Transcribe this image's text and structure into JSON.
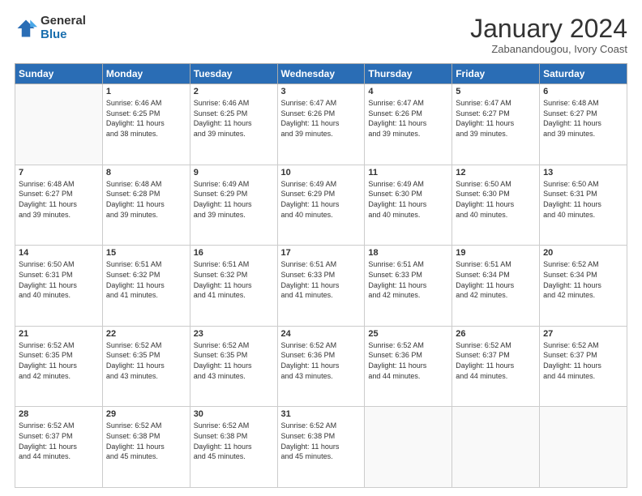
{
  "logo": {
    "general": "General",
    "blue": "Blue"
  },
  "header": {
    "month": "January 2024",
    "location": "Zabanandougou, Ivory Coast"
  },
  "weekdays": [
    "Sunday",
    "Monday",
    "Tuesday",
    "Wednesday",
    "Thursday",
    "Friday",
    "Saturday"
  ],
  "weeks": [
    [
      {
        "day": "",
        "info": ""
      },
      {
        "day": "1",
        "info": "Sunrise: 6:46 AM\nSunset: 6:25 PM\nDaylight: 11 hours\nand 38 minutes."
      },
      {
        "day": "2",
        "info": "Sunrise: 6:46 AM\nSunset: 6:25 PM\nDaylight: 11 hours\nand 39 minutes."
      },
      {
        "day": "3",
        "info": "Sunrise: 6:47 AM\nSunset: 6:26 PM\nDaylight: 11 hours\nand 39 minutes."
      },
      {
        "day": "4",
        "info": "Sunrise: 6:47 AM\nSunset: 6:26 PM\nDaylight: 11 hours\nand 39 minutes."
      },
      {
        "day": "5",
        "info": "Sunrise: 6:47 AM\nSunset: 6:27 PM\nDaylight: 11 hours\nand 39 minutes."
      },
      {
        "day": "6",
        "info": "Sunrise: 6:48 AM\nSunset: 6:27 PM\nDaylight: 11 hours\nand 39 minutes."
      }
    ],
    [
      {
        "day": "7",
        "info": "Sunrise: 6:48 AM\nSunset: 6:27 PM\nDaylight: 11 hours\nand 39 minutes."
      },
      {
        "day": "8",
        "info": "Sunrise: 6:48 AM\nSunset: 6:28 PM\nDaylight: 11 hours\nand 39 minutes."
      },
      {
        "day": "9",
        "info": "Sunrise: 6:49 AM\nSunset: 6:29 PM\nDaylight: 11 hours\nand 39 minutes."
      },
      {
        "day": "10",
        "info": "Sunrise: 6:49 AM\nSunset: 6:29 PM\nDaylight: 11 hours\nand 40 minutes."
      },
      {
        "day": "11",
        "info": "Sunrise: 6:49 AM\nSunset: 6:30 PM\nDaylight: 11 hours\nand 40 minutes."
      },
      {
        "day": "12",
        "info": "Sunrise: 6:50 AM\nSunset: 6:30 PM\nDaylight: 11 hours\nand 40 minutes."
      },
      {
        "day": "13",
        "info": "Sunrise: 6:50 AM\nSunset: 6:31 PM\nDaylight: 11 hours\nand 40 minutes."
      }
    ],
    [
      {
        "day": "14",
        "info": "Sunrise: 6:50 AM\nSunset: 6:31 PM\nDaylight: 11 hours\nand 40 minutes."
      },
      {
        "day": "15",
        "info": "Sunrise: 6:51 AM\nSunset: 6:32 PM\nDaylight: 11 hours\nand 41 minutes."
      },
      {
        "day": "16",
        "info": "Sunrise: 6:51 AM\nSunset: 6:32 PM\nDaylight: 11 hours\nand 41 minutes."
      },
      {
        "day": "17",
        "info": "Sunrise: 6:51 AM\nSunset: 6:33 PM\nDaylight: 11 hours\nand 41 minutes."
      },
      {
        "day": "18",
        "info": "Sunrise: 6:51 AM\nSunset: 6:33 PM\nDaylight: 11 hours\nand 42 minutes."
      },
      {
        "day": "19",
        "info": "Sunrise: 6:51 AM\nSunset: 6:34 PM\nDaylight: 11 hours\nand 42 minutes."
      },
      {
        "day": "20",
        "info": "Sunrise: 6:52 AM\nSunset: 6:34 PM\nDaylight: 11 hours\nand 42 minutes."
      }
    ],
    [
      {
        "day": "21",
        "info": "Sunrise: 6:52 AM\nSunset: 6:35 PM\nDaylight: 11 hours\nand 42 minutes."
      },
      {
        "day": "22",
        "info": "Sunrise: 6:52 AM\nSunset: 6:35 PM\nDaylight: 11 hours\nand 43 minutes."
      },
      {
        "day": "23",
        "info": "Sunrise: 6:52 AM\nSunset: 6:35 PM\nDaylight: 11 hours\nand 43 minutes."
      },
      {
        "day": "24",
        "info": "Sunrise: 6:52 AM\nSunset: 6:36 PM\nDaylight: 11 hours\nand 43 minutes."
      },
      {
        "day": "25",
        "info": "Sunrise: 6:52 AM\nSunset: 6:36 PM\nDaylight: 11 hours\nand 44 minutes."
      },
      {
        "day": "26",
        "info": "Sunrise: 6:52 AM\nSunset: 6:37 PM\nDaylight: 11 hours\nand 44 minutes."
      },
      {
        "day": "27",
        "info": "Sunrise: 6:52 AM\nSunset: 6:37 PM\nDaylight: 11 hours\nand 44 minutes."
      }
    ],
    [
      {
        "day": "28",
        "info": "Sunrise: 6:52 AM\nSunset: 6:37 PM\nDaylight: 11 hours\nand 44 minutes."
      },
      {
        "day": "29",
        "info": "Sunrise: 6:52 AM\nSunset: 6:38 PM\nDaylight: 11 hours\nand 45 minutes."
      },
      {
        "day": "30",
        "info": "Sunrise: 6:52 AM\nSunset: 6:38 PM\nDaylight: 11 hours\nand 45 minutes."
      },
      {
        "day": "31",
        "info": "Sunrise: 6:52 AM\nSunset: 6:38 PM\nDaylight: 11 hours\nand 45 minutes."
      },
      {
        "day": "",
        "info": ""
      },
      {
        "day": "",
        "info": ""
      },
      {
        "day": "",
        "info": ""
      }
    ]
  ]
}
